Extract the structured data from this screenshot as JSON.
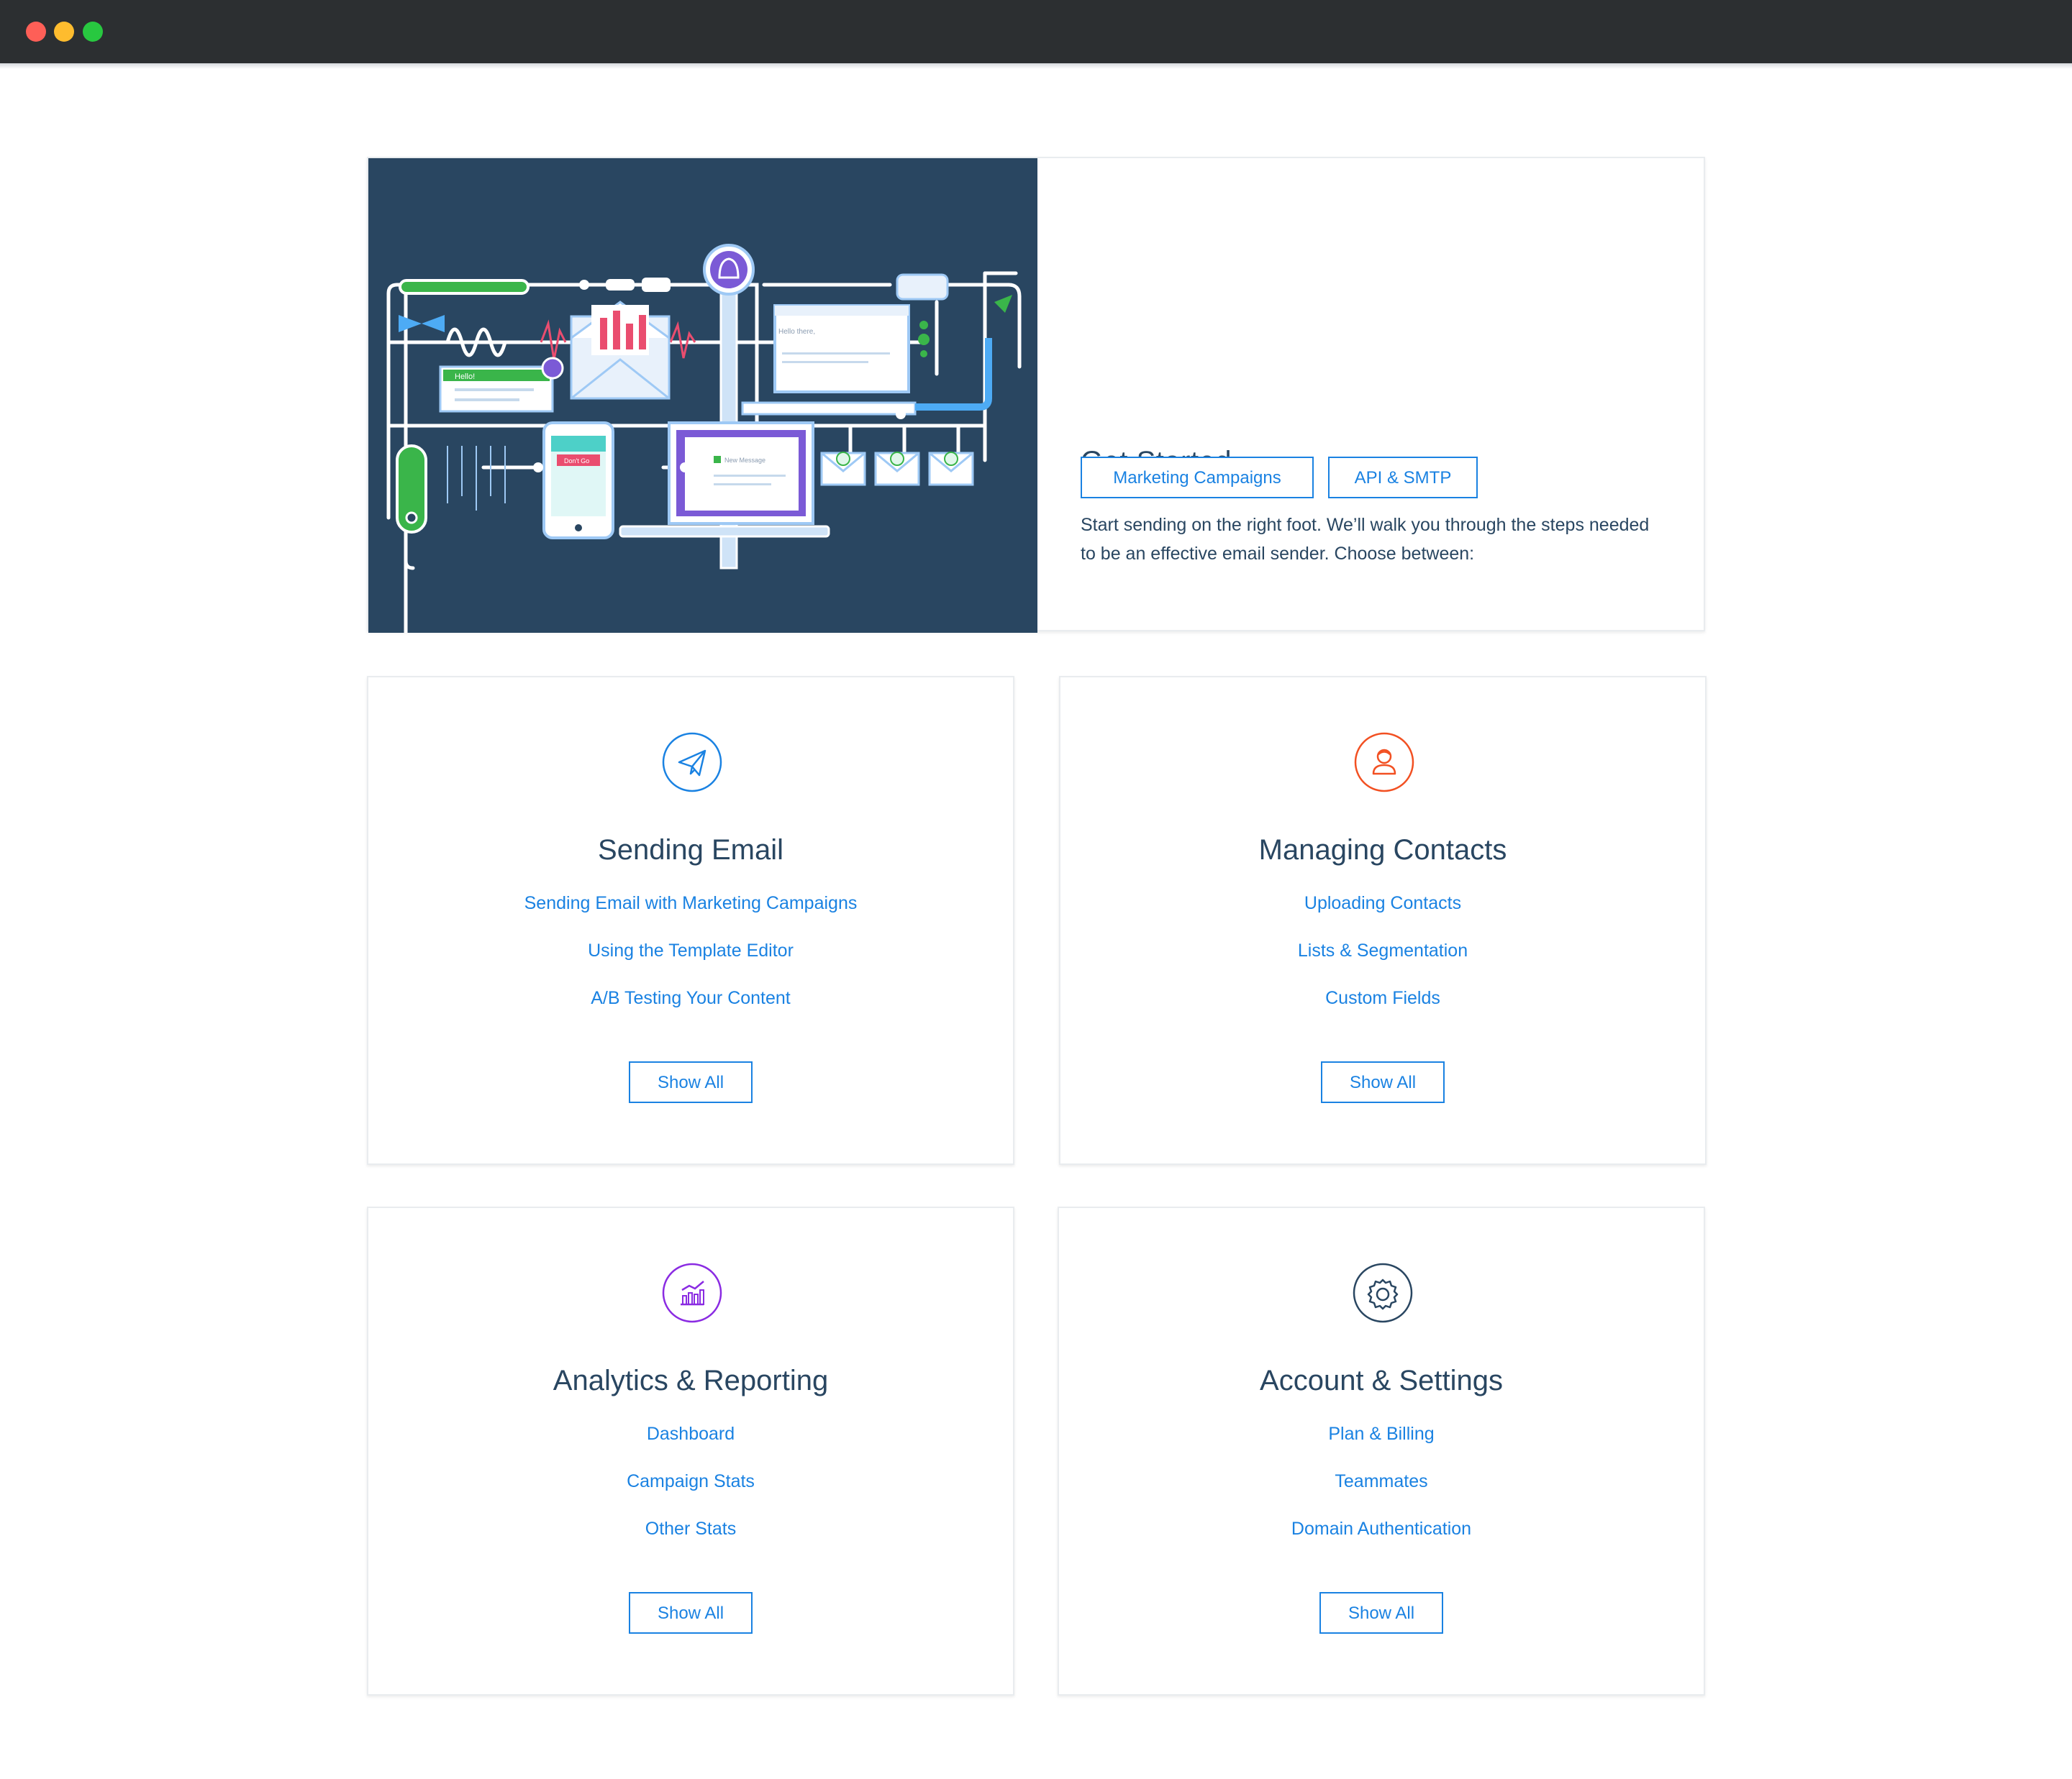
{
  "colors": {
    "accent": "#1a82e2",
    "heading": "#294661",
    "hero_background": "#294661",
    "icon_sending": "#1a82e2",
    "icon_contacts": "#f25022",
    "icon_analytics": "#8a2be2",
    "icon_account": "#294661"
  },
  "hero": {
    "title": "Get Started",
    "description": "Start sending on the right foot. We’ll walk you through the steps needed to be an effective email sender. Choose between:",
    "buttons": [
      "Marketing Campaigns",
      "API & SMTP"
    ],
    "illustration_labels": [
      "Hello!",
      "Hello there,",
      "Don't Go",
      "New Message"
    ]
  },
  "tiles": [
    {
      "icon": "paper-plane-icon",
      "title": "Sending Email",
      "links": [
        "Sending Email with Marketing Campaigns",
        "Using the Template Editor",
        "A/B Testing Your Content"
      ],
      "button": "Show All"
    },
    {
      "icon": "contact-person-icon",
      "title": "Managing Contacts",
      "links": [
        "Uploading Contacts",
        "Lists & Segmentation",
        "Custom Fields"
      ],
      "button": "Show All"
    },
    {
      "icon": "bar-chart-icon",
      "title": "Analytics & Reporting",
      "links": [
        "Dashboard",
        "Campaign Stats",
        "Other Stats"
      ],
      "button": "Show All"
    },
    {
      "icon": "gear-icon",
      "title": "Account & Settings",
      "links": [
        "Plan & Billing",
        "Teammates",
        "Domain Authentication"
      ],
      "button": "Show All"
    }
  ]
}
